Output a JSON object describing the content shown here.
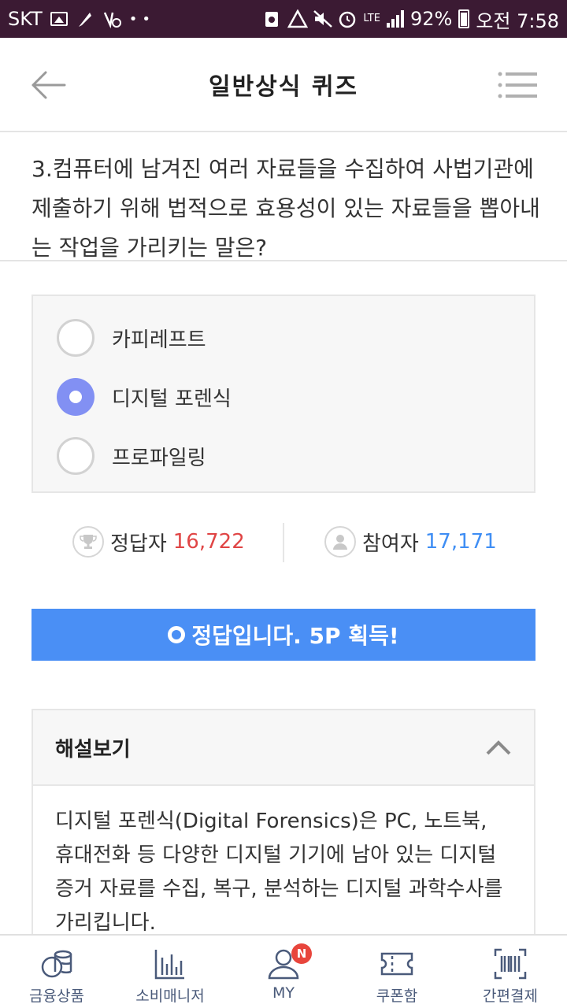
{
  "status_bar": {
    "carrier": "SKT",
    "network": "LTE",
    "battery": "92%",
    "time": "오전 7:58"
  },
  "header": {
    "title": "일반상식 퀴즈"
  },
  "question": {
    "text": "3.컴퓨터에 남겨진 여러 자료들을 수집하여 사법기관에 제출하기 위해 법적으로 효용성이 있는 자료들을 뽑아내는 작업을 가리키는 말은?"
  },
  "options": [
    {
      "label": "카피레프트",
      "selected": false
    },
    {
      "label": "디지털 포렌식",
      "selected": true
    },
    {
      "label": "프로파일링",
      "selected": false
    }
  ],
  "stats": {
    "correct_label": "정답자",
    "correct_count": "16,722",
    "participants_label": "참여자",
    "participants_count": "17,171"
  },
  "result": {
    "text": "정답입니다. 5P 획득!"
  },
  "explanation": {
    "title": "해설보기",
    "body": "디지털 포렌식(Digital Forensics)은 PC, 노트북, 휴대전화 등 다양한 디지털 기기에 남아 있는 디지털 증거 자료를 수집, 복구, 분석하는 디지털 과학수사를 가리킵니다."
  },
  "bottom_nav": [
    {
      "label": "금융상품",
      "icon": "coins-icon"
    },
    {
      "label": "소비매니저",
      "icon": "bar-chart-icon"
    },
    {
      "label": "MY",
      "icon": "user-icon",
      "badge": "N"
    },
    {
      "label": "쿠폰함",
      "icon": "coupon-icon"
    },
    {
      "label": "간편결제",
      "icon": "barcode-icon"
    }
  ],
  "colors": {
    "status_bar": "#3b1a33",
    "accent_blue": "#4a8ff5",
    "radio_selected": "#8290f3",
    "count_red": "#e04545",
    "count_blue": "#3f8ef4",
    "badge": "#e8453c"
  }
}
